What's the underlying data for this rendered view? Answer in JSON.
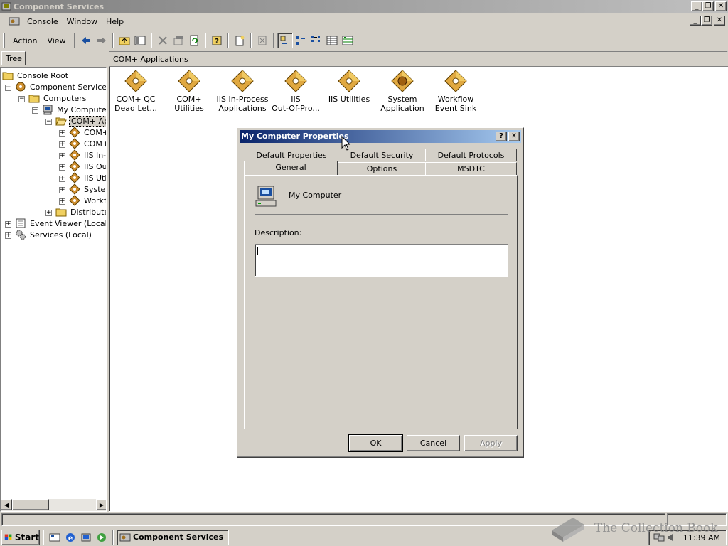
{
  "window": {
    "title": "Component Services"
  },
  "menubar": {
    "items": [
      "Console",
      "Window",
      "Help"
    ]
  },
  "toolbar": {
    "action_label": "Action",
    "view_label": "View"
  },
  "left_pane": {
    "tab_label": "Tree",
    "tree": [
      {
        "label": "Console Root"
      },
      {
        "label": "Component Services"
      },
      {
        "label": "Computers"
      },
      {
        "label": "My Computer"
      },
      {
        "label": "COM+ Ap"
      },
      {
        "label": "COM+"
      },
      {
        "label": "COM+"
      },
      {
        "label": "IIS In-"
      },
      {
        "label": "IIS Ou"
      },
      {
        "label": "IIS Uti"
      },
      {
        "label": "Syster"
      },
      {
        "label": "Workf"
      },
      {
        "label": "Distributed"
      },
      {
        "label": "Event Viewer (Local)"
      },
      {
        "label": "Services (Local)"
      }
    ]
  },
  "right_pane": {
    "header": "COM+ Applications",
    "apps": [
      {
        "line1": "COM+ QC",
        "line2": "Dead Let..."
      },
      {
        "line1": "COM+ Utilities",
        "line2": ""
      },
      {
        "line1": "IIS In-Process",
        "line2": "Applications"
      },
      {
        "line1": "IIS",
        "line2": "Out-Of-Pro..."
      },
      {
        "line1": "IIS Utilities",
        "line2": ""
      },
      {
        "line1": "System",
        "line2": "Application"
      },
      {
        "line1": "Workflow",
        "line2": "Event Sink"
      }
    ]
  },
  "dialog": {
    "title": "My Computer Properties",
    "help_glyph": "?",
    "close_glyph": "✕",
    "tabs_row1": [
      "Default Properties",
      "Default Security",
      "Default Protocols"
    ],
    "tabs_row2": [
      "General",
      "Options",
      "MSDTC"
    ],
    "active_tab": "General",
    "computer_name": "My Computer",
    "description_label": "Description:",
    "description_value": "",
    "buttons": {
      "ok": "OK",
      "cancel": "Cancel",
      "apply": "Apply"
    }
  },
  "taskbar": {
    "start_label": "Start",
    "task_button": "Component Services",
    "clock": "11:39 AM"
  },
  "watermark": "The Collection Book"
}
